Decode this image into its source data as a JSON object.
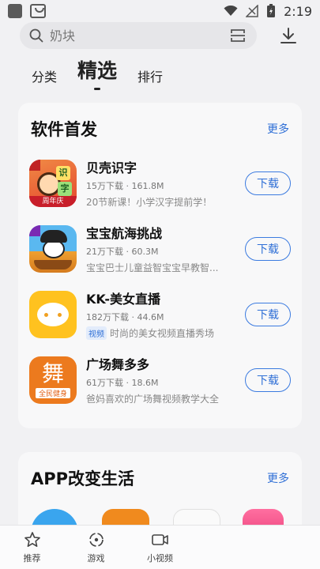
{
  "status_bar": {
    "time": "2:19"
  },
  "search": {
    "placeholder": "奶块"
  },
  "tabs": [
    {
      "label": "分类"
    },
    {
      "label": "精选"
    },
    {
      "label": "排行"
    }
  ],
  "section_first_release": {
    "title": "软件首发",
    "more": "更多",
    "apps": [
      {
        "name": "贝壳识字",
        "meta": "15万下载 · 161.8M",
        "desc": "20节新课！小学汉字提前学！",
        "button": "下载",
        "icon_badge": "周年庆",
        "icon_chars": [
          "识",
          "字"
        ]
      },
      {
        "name": "宝宝航海挑战",
        "meta": "21万下载 · 60.3M",
        "desc": "宝宝巴士儿童益智宝宝早教智...",
        "button": "下载"
      },
      {
        "name": "KK-美女直播",
        "meta": "182万下载 · 44.6M",
        "tag": "视频",
        "desc": "时尚的美女视频直播秀场",
        "button": "下载"
      },
      {
        "name": "广场舞多多",
        "meta": "61万下载 · 18.6M",
        "desc": "爸妈喜欢的广场舞视频教学大全",
        "button": "下载",
        "icon_glyph": "舞",
        "icon_caption": "全民健身"
      }
    ]
  },
  "section_app_life": {
    "title": "APP改变生活",
    "more": "更多"
  },
  "bottom_nav": [
    {
      "label": "推荐",
      "icon": "star-icon"
    },
    {
      "label": "游戏",
      "icon": "game-icon"
    },
    {
      "label": "小视频",
      "icon": "video-icon"
    }
  ]
}
